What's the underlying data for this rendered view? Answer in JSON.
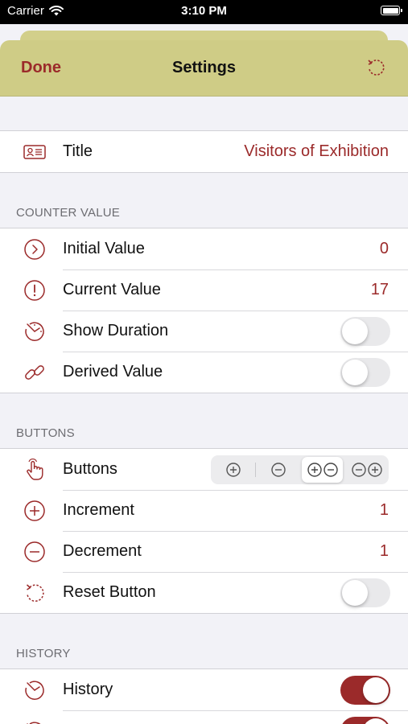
{
  "status_bar": {
    "carrier": "Carrier",
    "time": "3:10 PM"
  },
  "nav": {
    "done_label": "Done",
    "title": "Settings",
    "reset_icon": "reset-icon"
  },
  "title_row": {
    "label": "Title",
    "value": "Visitors of Exhibition",
    "icon": "contact-card-icon"
  },
  "counter_value": {
    "header": "COUNTER VALUE",
    "rows": [
      {
        "label": "Initial Value",
        "value": "0",
        "icon": "chevron-circle-icon"
      },
      {
        "label": "Current Value",
        "value": "17",
        "icon": "exclamation-circle-icon"
      },
      {
        "label": "Show Duration",
        "toggle": false,
        "icon": "timer-icon"
      },
      {
        "label": "Derived Value",
        "toggle": false,
        "icon": "link-icon"
      }
    ]
  },
  "buttons": {
    "header": "BUTTONS",
    "rows": [
      {
        "label": "Buttons",
        "icon": "tap-hand-icon",
        "segments": [
          "plus",
          "minus",
          "plus-minus",
          "minus-plus"
        ],
        "selected_segment": "plus-minus"
      },
      {
        "label": "Increment",
        "value": "1",
        "icon": "plus-circle-icon"
      },
      {
        "label": "Decrement",
        "value": "1",
        "icon": "minus-circle-icon"
      },
      {
        "label": "Reset Button",
        "toggle": false,
        "icon": "reset-icon"
      }
    ]
  },
  "history": {
    "header": "HISTORY",
    "rows": [
      {
        "label": "History",
        "toggle": true,
        "icon": "timer-icon"
      },
      {
        "label": "",
        "toggle": true,
        "icon": "timer-icon"
      }
    ]
  },
  "colors": {
    "accent": "#9b2a2a",
    "navbar": "#cfcc86",
    "background": "#f2f2f7"
  }
}
